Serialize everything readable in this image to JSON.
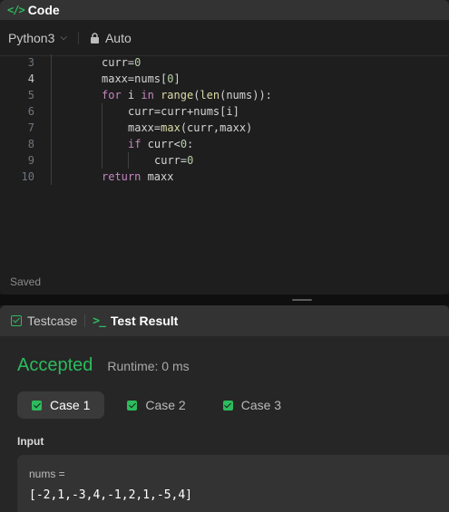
{
  "code_panel": {
    "title": "Code",
    "language": "Python3",
    "mode": "Auto",
    "status": "Saved"
  },
  "editor": {
    "lines": [
      {
        "no": "3",
        "text": "curr=0"
      },
      {
        "no": "4",
        "text": "maxx=nums[0]"
      },
      {
        "no": "5",
        "text": "for i in range(len(nums)):"
      },
      {
        "no": "6",
        "text": "curr=curr+nums[i]"
      },
      {
        "no": "7",
        "text": "maxx=max(curr,maxx)"
      },
      {
        "no": "8",
        "text": "if curr<0:"
      },
      {
        "no": "9",
        "text": "curr=0"
      },
      {
        "no": "10",
        "text": "return maxx"
      }
    ]
  },
  "result_panel": {
    "tab_testcase": "Testcase",
    "tab_result": "Test Result",
    "status": "Accepted",
    "runtime": "Runtime: 0 ms",
    "cases": [
      "Case 1",
      "Case 2",
      "Case 3"
    ],
    "input_label": "Input",
    "var_name": "nums =",
    "var_value": "[-2,1,-3,4,-1,2,1,-5,4]"
  },
  "colors": {
    "accent_green": "#2cbb5d",
    "background": "#1e1e1e"
  }
}
